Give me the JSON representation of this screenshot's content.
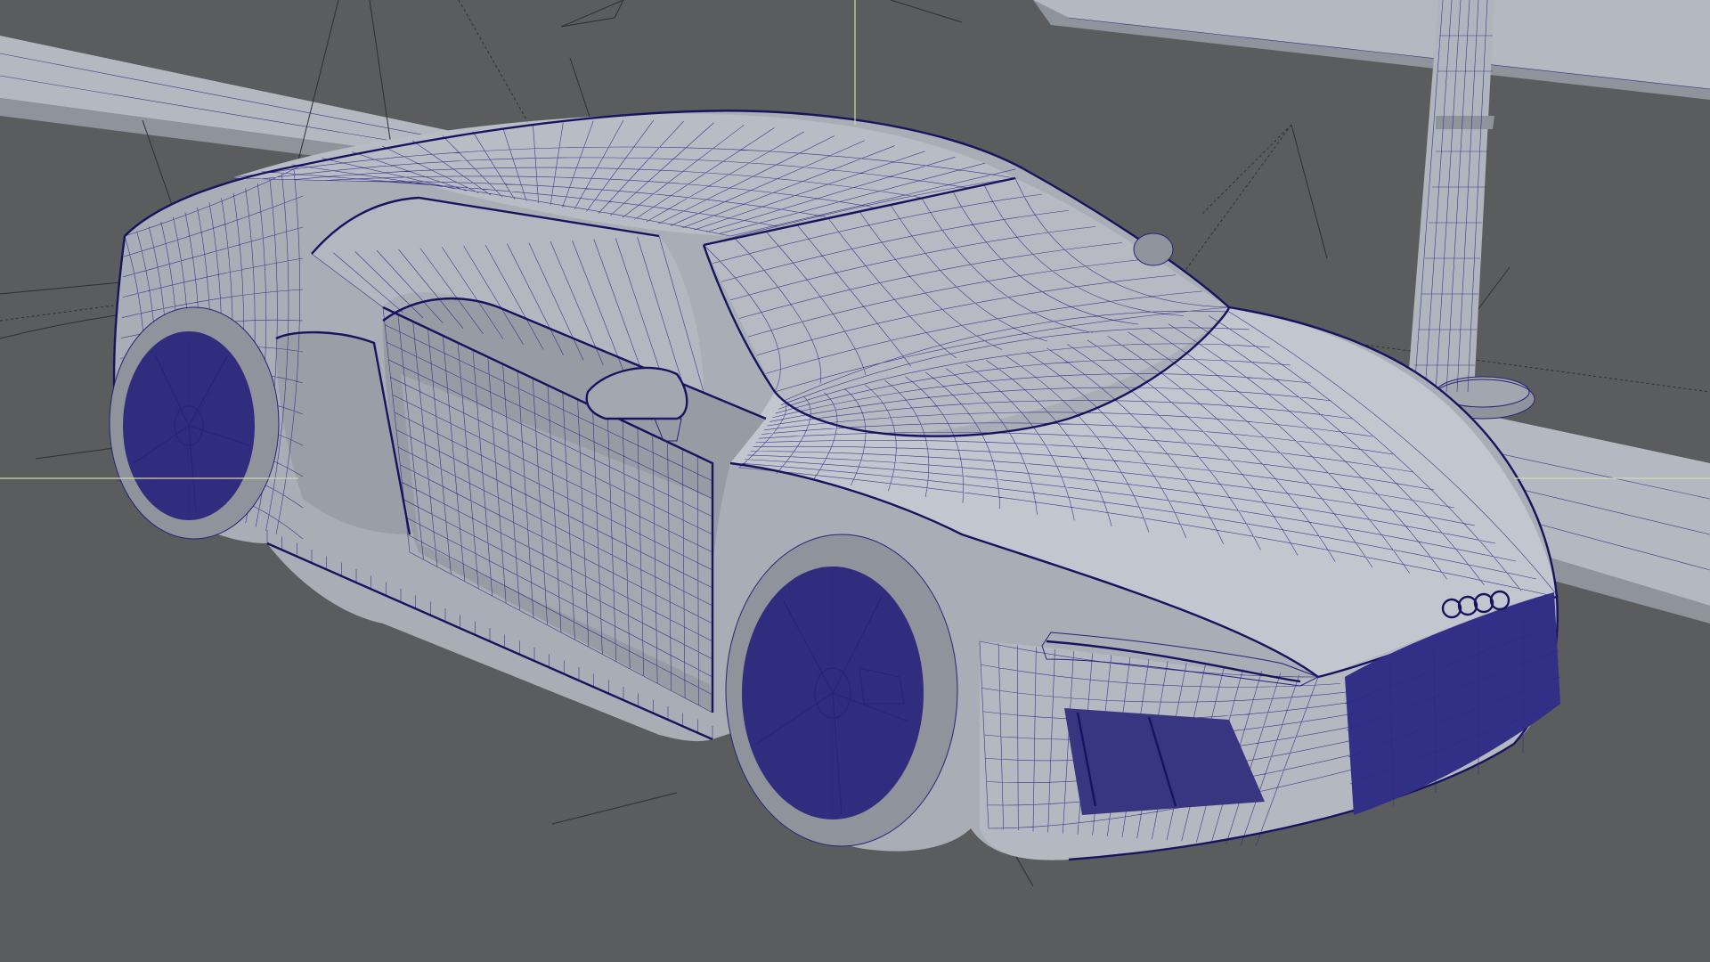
{
  "viewport": {
    "mode": "wireframe-on-shaded",
    "colors": {
      "background": "#5b5c5d",
      "sidewalk": "#b4b8c1",
      "curb_dark": "#8f939b",
      "body_shade": "#a9adb6",
      "body_shade_light": "#c2c6ce",
      "glass_shade": "#b7bac2",
      "wireframe": "#25237a",
      "wheel": "#302c7e",
      "crosshair": "#d6d6b2"
    }
  },
  "objects": [
    {
      "name": "car-body",
      "type": "mesh"
    },
    {
      "name": "front-wheel",
      "type": "mesh"
    },
    {
      "name": "rear-wheel",
      "type": "mesh"
    },
    {
      "name": "street-pole",
      "type": "mesh"
    },
    {
      "name": "sidewalk",
      "type": "mesh"
    },
    {
      "name": "curb",
      "type": "mesh"
    }
  ]
}
